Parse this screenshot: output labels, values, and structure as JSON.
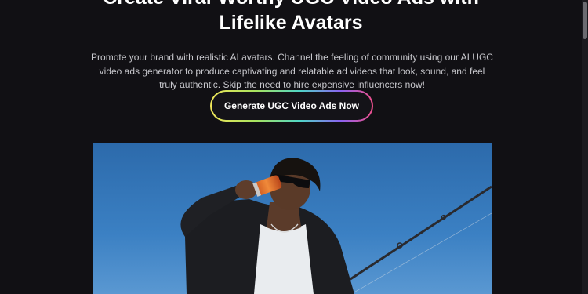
{
  "hero": {
    "headline_line1": "Create Viral-Worthy UGC Video Ads with",
    "headline_line2": "Lifelike Avatars",
    "description": "Promote your brand with realistic AI avatars. Channel the feeling of community using our AI UGC video ads generator to produce captivating and relatable ad videos that look, sound, and feel truly authentic. Skip the need to hire expensive influencers now!",
    "cta_label": "Generate UGC Video Ads Now"
  },
  "image": {
    "subject": "person-drinking-from-can-with-fishing-rod"
  },
  "colors": {
    "background": "#111014",
    "text": "#ffffff",
    "muted_text": "#c7c7cc",
    "sky": "#3f83c5"
  }
}
